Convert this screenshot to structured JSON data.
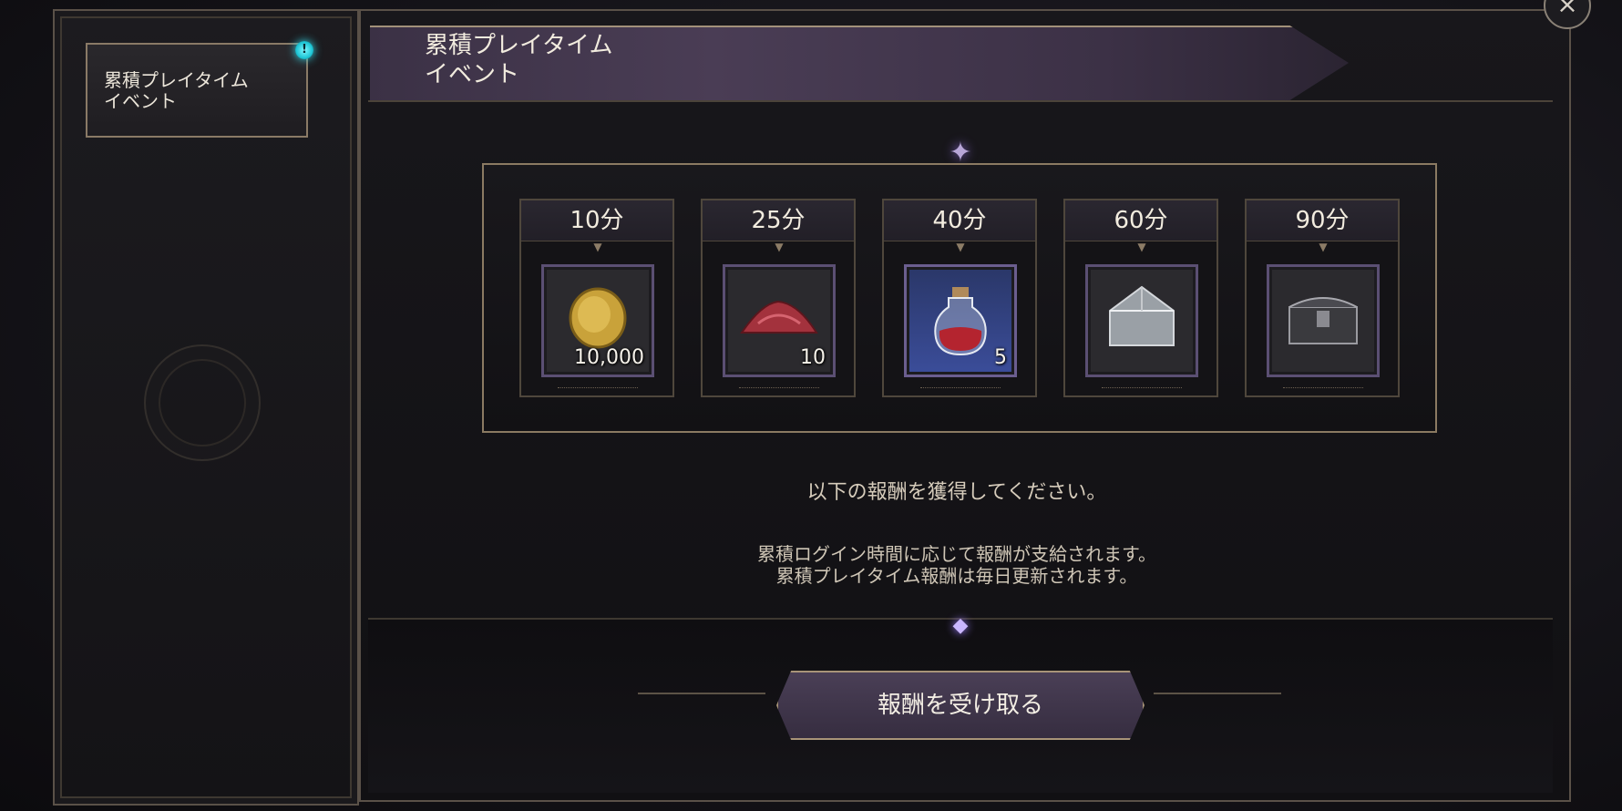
{
  "sidebar": {
    "items": [
      {
        "label": "累積プレイタイム\nイベント",
        "badge": "!"
      }
    ]
  },
  "header": {
    "title": "累積プレイタイム\nイベント",
    "close_icon": "×"
  },
  "rewards": [
    {
      "time": "10分",
      "icon": "gold-coin-icon",
      "quantity": "10,000",
      "rarity": "common"
    },
    {
      "time": "25分",
      "icon": "red-powder-icon",
      "quantity": "10",
      "rarity": "common"
    },
    {
      "time": "40分",
      "icon": "potion-bottle-icon",
      "quantity": "5",
      "rarity": "rare"
    },
    {
      "time": "60分",
      "icon": "silver-box-icon",
      "quantity": "",
      "rarity": "common"
    },
    {
      "time": "90分",
      "icon": "iron-chest-icon",
      "quantity": "",
      "rarity": "common"
    }
  ],
  "message": {
    "main": "以下の報酬を獲得してください。",
    "sub": "累積ログイン時間に応じて報酬が支給されます。\n累積プレイタイム報酬は毎日更新されます。"
  },
  "claim_button": {
    "label": "報酬を受け取る"
  },
  "colors": {
    "accent_purple": "#4a3f56",
    "frame_gold": "#8b7a62",
    "notification_cyan": "#36e2f2"
  }
}
